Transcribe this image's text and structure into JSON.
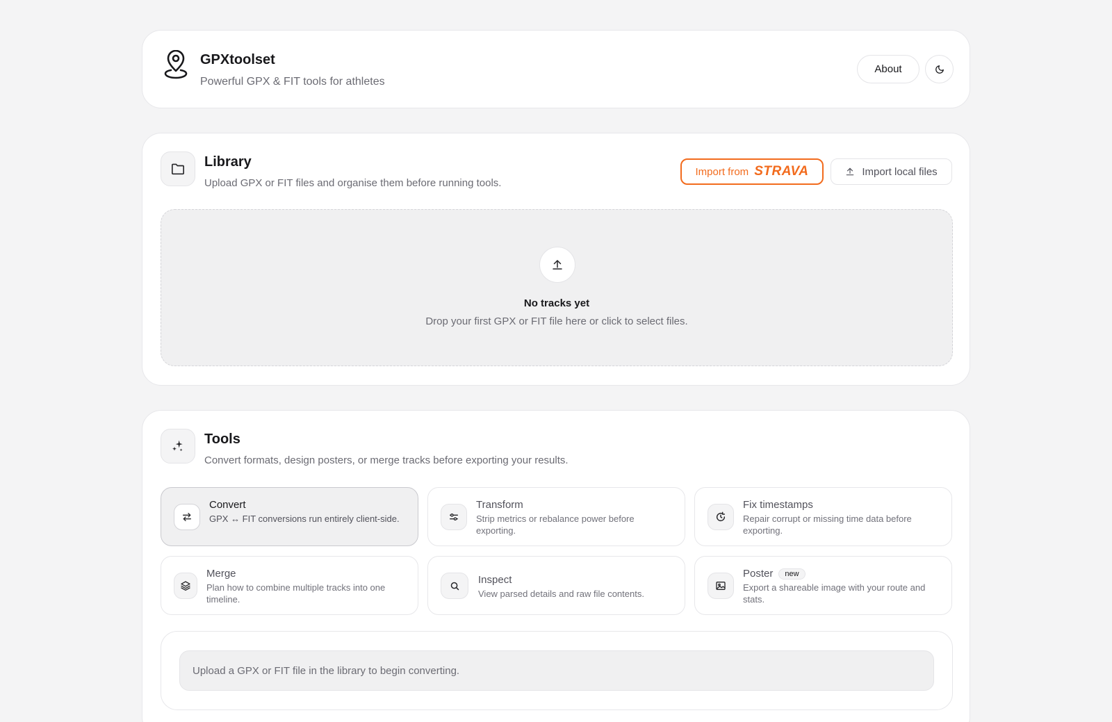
{
  "header": {
    "title": "GPXtoolset",
    "subtitle": "Powerful GPX & FIT tools for athletes",
    "about_label": "About",
    "logo_icon": "map-pin-icon",
    "theme_icon": "moon-icon"
  },
  "library": {
    "title": "Library",
    "subtitle": "Upload GPX or FIT files and organise them before running tools.",
    "icon": "folder-icon",
    "strava_button": {
      "label": "Import from",
      "brand": "STRAVA"
    },
    "local_button": {
      "label": "Import local files",
      "icon": "upload-icon"
    },
    "dropzone": {
      "title": "No tracks yet",
      "subtitle": "Drop your first GPX or FIT file here or click to select files.",
      "icon": "upload-icon"
    }
  },
  "tools": {
    "title": "Tools",
    "subtitle": "Convert formats, design posters, or merge tracks before exporting your results.",
    "icon": "sparkles-icon",
    "items": [
      {
        "name": "Convert",
        "description": "GPX ↔ FIT conversions run entirely client-side.",
        "icon": "arrows-swap-icon",
        "active": true
      },
      {
        "name": "Transform",
        "description": "Strip metrics or rebalance power before exporting.",
        "icon": "sliders-icon"
      },
      {
        "name": "Fix timestamps",
        "description": "Repair corrupt or missing time data before exporting.",
        "icon": "clock-refresh-icon"
      },
      {
        "name": "Merge",
        "description": "Plan how to combine multiple tracks into one timeline.",
        "icon": "layers-icon"
      },
      {
        "name": "Inspect",
        "description": "View parsed details and raw file contents.",
        "icon": "search-icon"
      },
      {
        "name": "Poster",
        "badge": "new",
        "description": "Export a shareable image with your route and stats.",
        "icon": "image-icon"
      }
    ],
    "status_message": "Upload a GPX or FIT file in the library to begin converting."
  },
  "colors": {
    "strava_orange": "#f26b1d",
    "background": "#f4f4f5",
    "card": "#ffffff"
  }
}
